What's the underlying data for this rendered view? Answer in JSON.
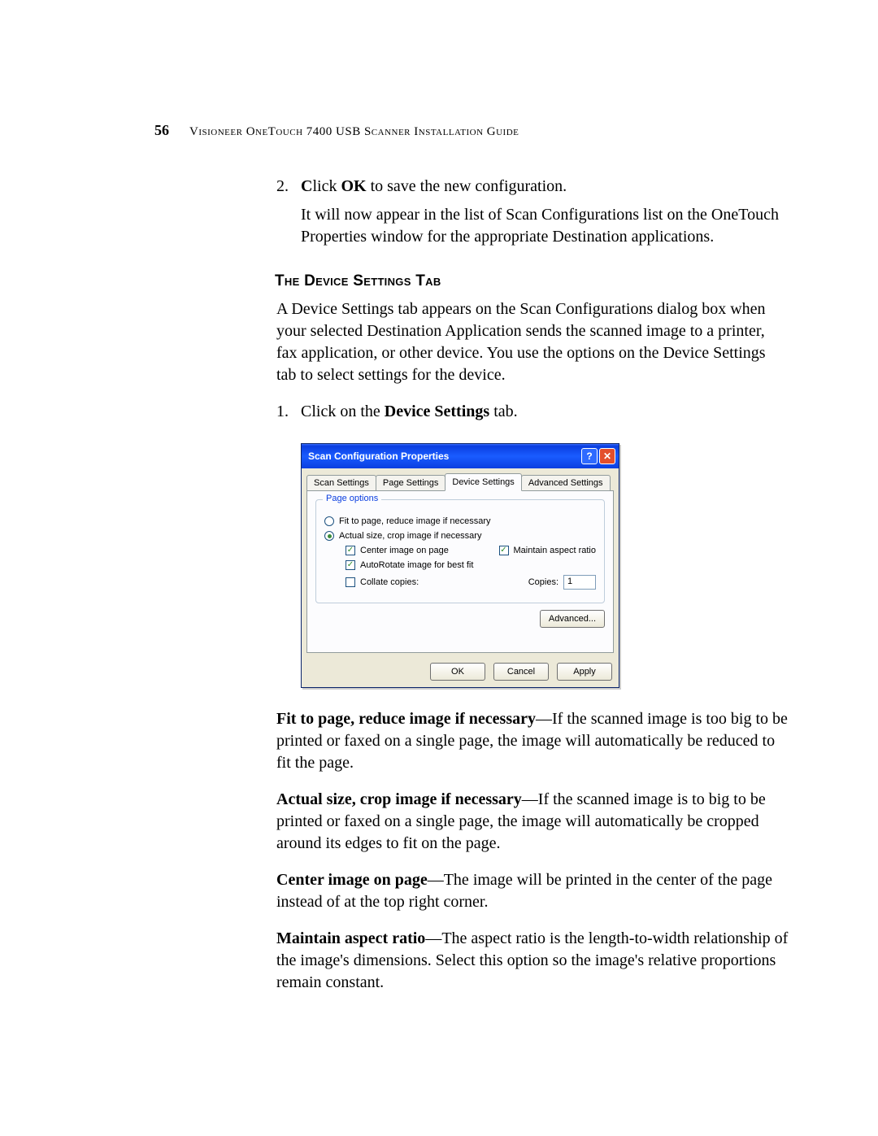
{
  "page": {
    "number": "56",
    "header": "Visioneer OneTouch 7400 USB Scanner Installation Guide"
  },
  "step2": {
    "num": "2.",
    "line_pre": "C",
    "line_mid": "lick ",
    "line_bold": "OK",
    "line_post": " to save the new configuration.",
    "para": "It will now appear in the list of Scan Configurations list on the OneTouch Properties window for the appropriate Destination applications."
  },
  "section": {
    "heading": "The Device Settings Tab",
    "intro": "A Device Settings tab appears on the Scan Configurations dialog box when your selected Destination Application sends the scanned image to a printer, fax application, or other device. You use the options on the Device Settings tab to select settings for the device."
  },
  "step1": {
    "num": "1.",
    "pre": "Click on the ",
    "bold": "Device Settings",
    "post": " tab."
  },
  "dialog": {
    "title": "Scan Configuration Properties",
    "help": "?",
    "close": "✕",
    "tabs": {
      "scan": "Scan Settings",
      "page": "Page Settings",
      "device": "Device Settings",
      "advanced": "Advanced Settings"
    },
    "group_legend": "Page options",
    "radio_fit": "Fit to page, reduce image if necessary",
    "radio_actual": "Actual size, crop image if necessary",
    "chk_center": "Center image on page",
    "chk_aspect": "Maintain aspect ratio",
    "chk_autorotate": "AutoRotate image for best fit",
    "chk_collate": "Collate copies:",
    "copies_label": "Copies:",
    "copies_value": "1",
    "advanced_btn": "Advanced...",
    "ok": "OK",
    "cancel": "Cancel",
    "apply": "Apply"
  },
  "defs": {
    "fit": {
      "b": "Fit to page, reduce image if necessary",
      "t": "—If the scanned image is too big to be printed or faxed on a single page, the image will automatically be reduced to fit the page."
    },
    "actual": {
      "b": "Actual size, crop image if necessary",
      "t": "—If the scanned image is to big to be printed or faxed on a single page, the image will automatically be cropped around its edges to fit on the page."
    },
    "center": {
      "b": "Center image on page",
      "t": "—The image will be printed in the center of the page instead of at the top right corner."
    },
    "aspect": {
      "b": "Maintain aspect ratio",
      "t": "—The aspect ratio is the length-to-width relationship of the image's dimensions. Select this option so the image's relative proportions remain constant."
    }
  }
}
